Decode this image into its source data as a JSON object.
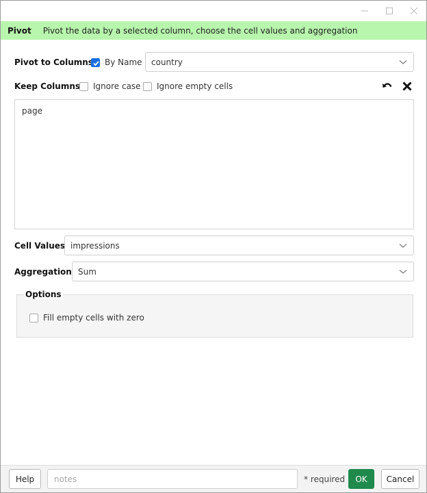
{
  "window": {
    "title": ""
  },
  "banner": {
    "title": "Pivot",
    "description": "Pivot the data by a selected column, choose the cell values and aggregation",
    "color": "#b8f5ad"
  },
  "pivot": {
    "label": "Pivot to Columns",
    "by_name_label": "By Name",
    "by_name_checked": true,
    "column_value": "country"
  },
  "keep": {
    "label": "Keep Columns",
    "ignore_case_label": "Ignore case",
    "ignore_case_checked": false,
    "ignore_empty_label": "Ignore empty cells",
    "ignore_empty_checked": false,
    "text": "page",
    "undo_icon": "undo-icon",
    "clear_icon": "close-icon"
  },
  "cell_values": {
    "label": "Cell Values",
    "value": "impressions"
  },
  "aggregation": {
    "label": "Aggregation",
    "value": "Sum"
  },
  "options": {
    "title": "Options",
    "fill_zero_label": "Fill empty cells with zero",
    "fill_zero_checked": false
  },
  "footer": {
    "help_label": "Help",
    "notes_placeholder": "notes",
    "required_label": "* required",
    "ok_label": "OK",
    "cancel_label": "Cancel",
    "ok_color": "#1f8a4c"
  },
  "colors": {
    "accent": "#1a6fe0"
  }
}
